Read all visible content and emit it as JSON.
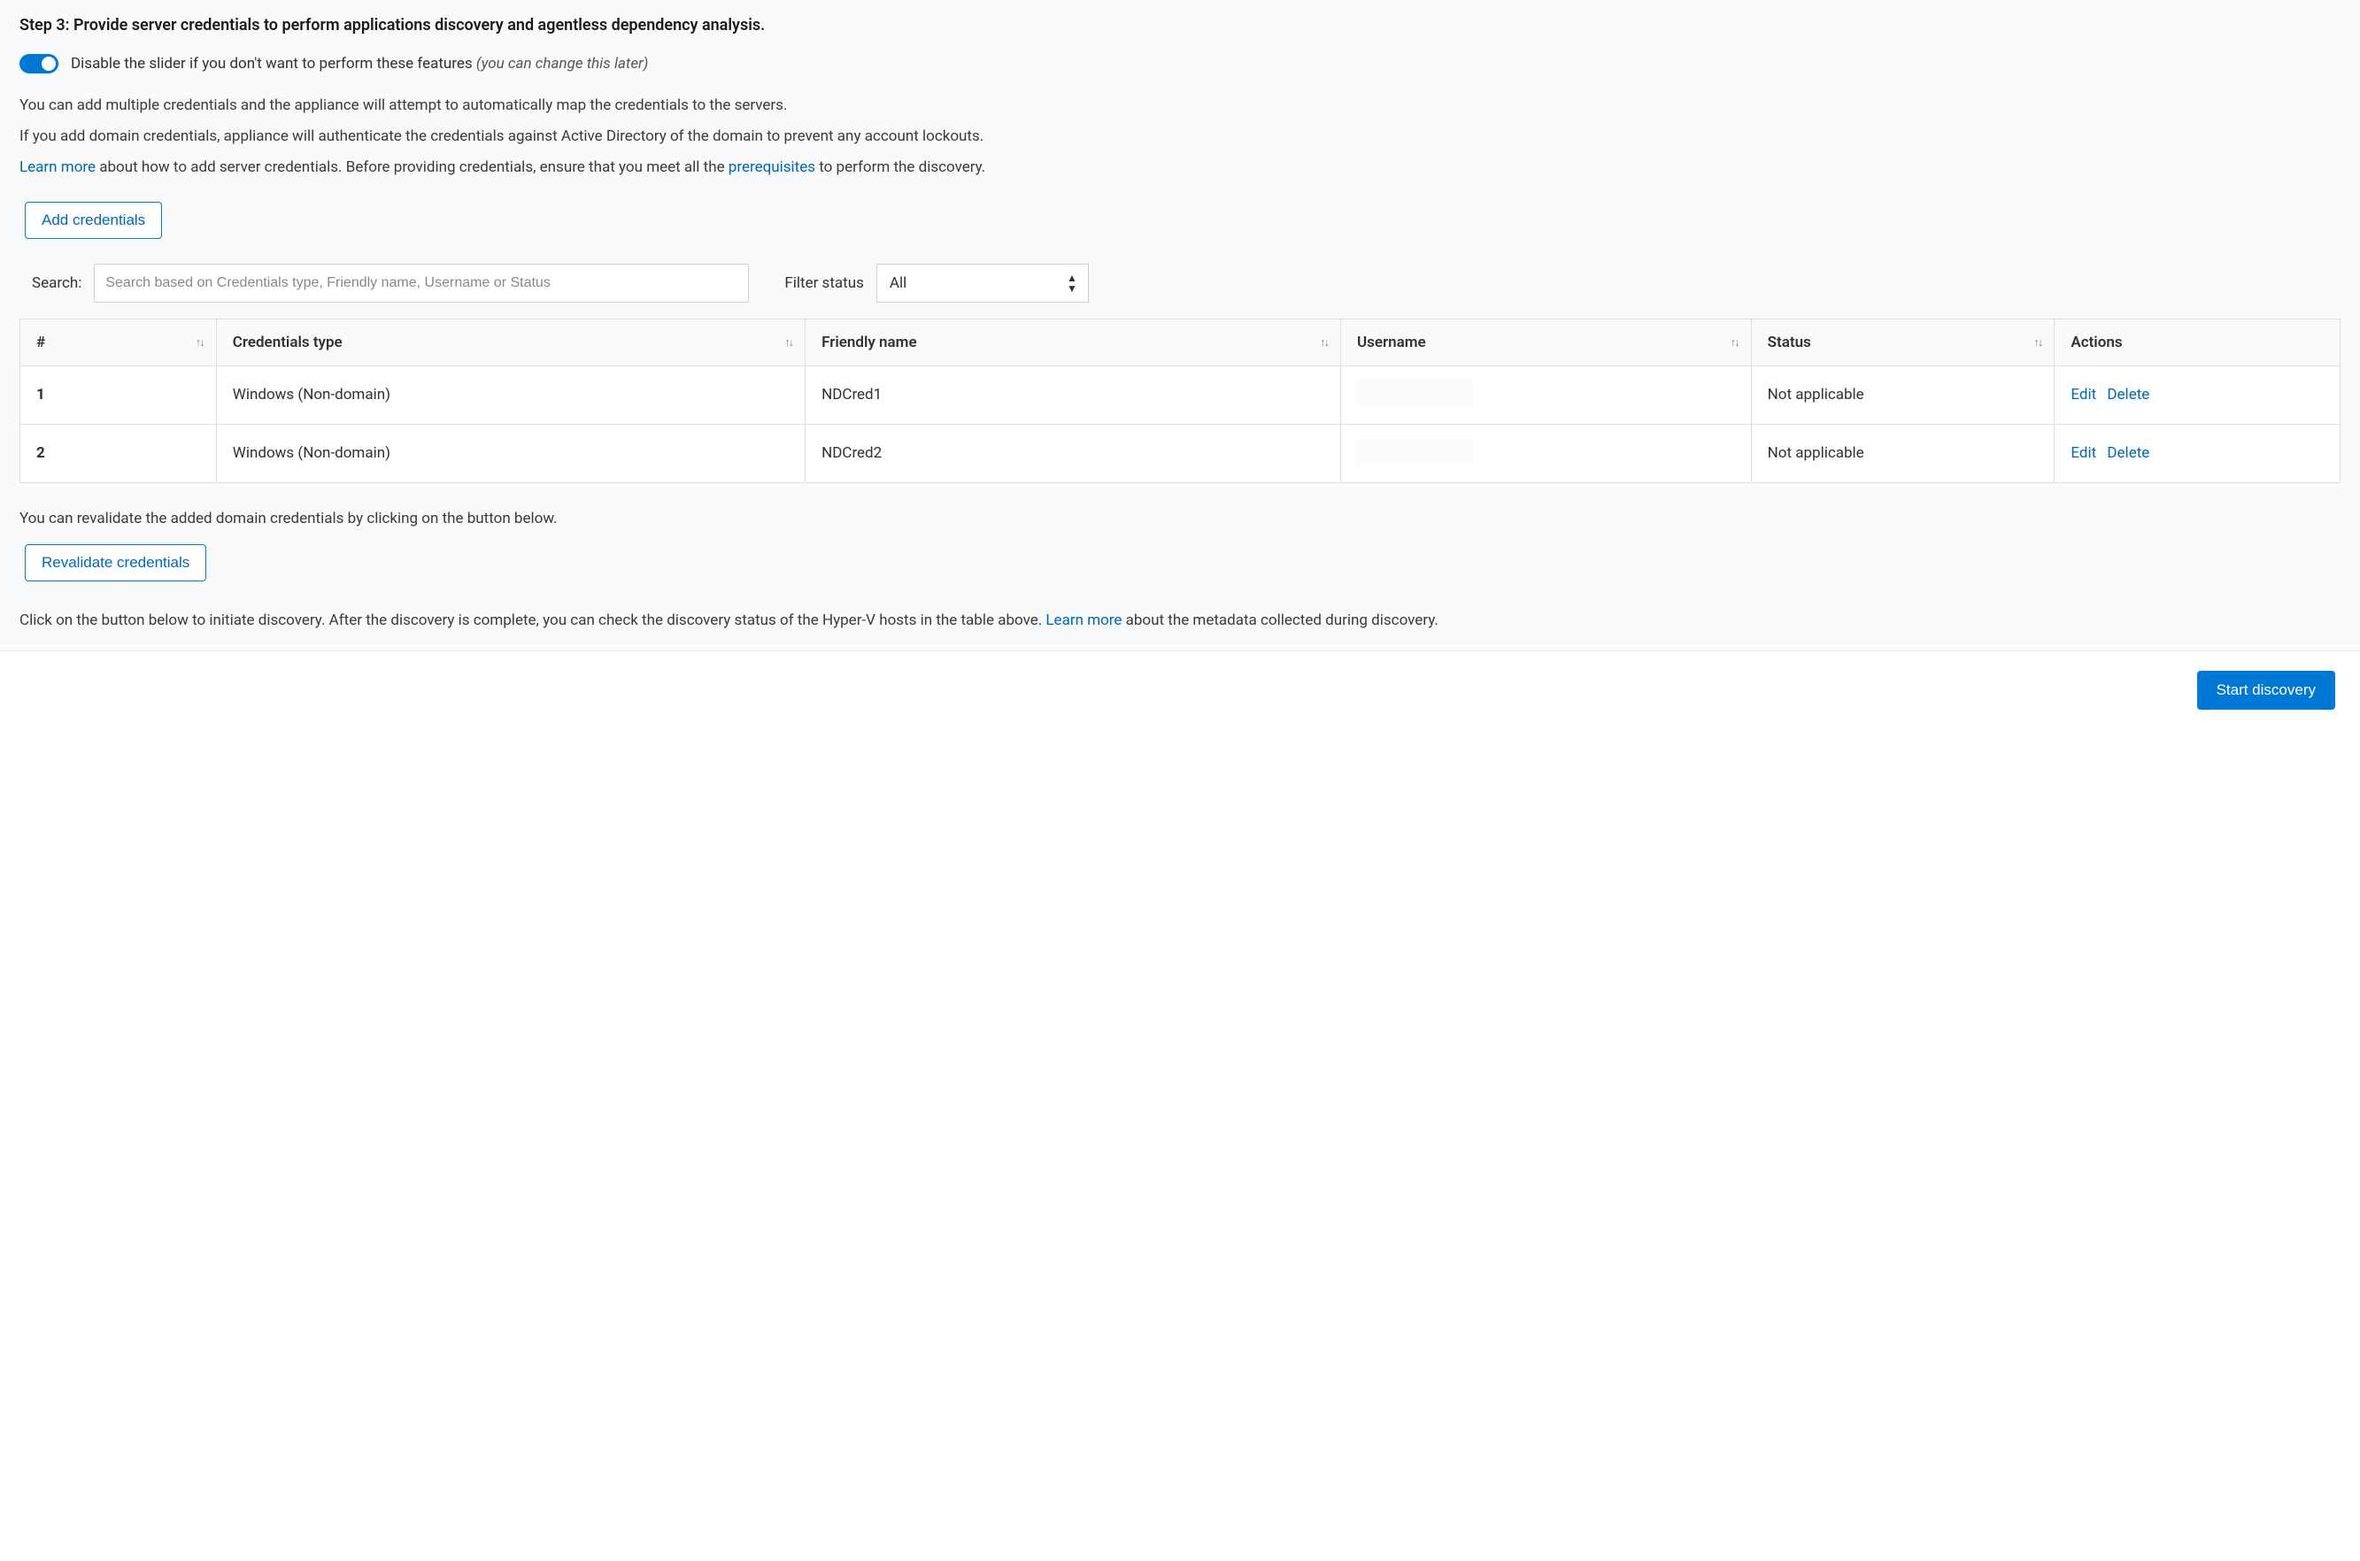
{
  "header": {
    "title": "Step 3: Provide server credentials to perform applications discovery and agentless dependency analysis."
  },
  "toggle": {
    "label_main": "Disable the slider if you don't want to perform these features ",
    "label_hint": "(you can change this later)"
  },
  "intro": {
    "line1": "You can add multiple credentials and the appliance will attempt to automatically map the credentials to the servers.",
    "line2": "If you add domain credentials, appliance will authenticate the credentials against Active Directory of the domain to prevent any account lockouts.",
    "line3_link": "Learn more",
    "line3_mid": " about how to add server credentials. Before providing credentials, ensure that you meet all the ",
    "line3_link2": "prerequisites",
    "line3_end": " to perform the discovery."
  },
  "buttons": {
    "add_credentials": "Add credentials",
    "revalidate": "Revalidate credentials",
    "start_discovery": "Start discovery"
  },
  "search": {
    "label": "Search:",
    "placeholder": "Search based on Credentials type, Friendly name, Username or Status"
  },
  "filter": {
    "label": "Filter status",
    "value": "All"
  },
  "table": {
    "headers": {
      "num": "#",
      "type": "Credentials type",
      "friendly": "Friendly name",
      "username": "Username",
      "status": "Status",
      "actions": "Actions"
    },
    "rows": [
      {
        "num": "1",
        "type": "Windows (Non-domain)",
        "friendly": "NDCred1",
        "username": "",
        "status": "Not applicable"
      },
      {
        "num": "2",
        "type": "Windows (Non-domain)",
        "friendly": "NDCred2",
        "username": "",
        "status": "Not applicable"
      }
    ],
    "action_edit": "Edit",
    "action_delete": "Delete"
  },
  "revalidate_text": "You can revalidate the added domain credentials by clicking on the button below.",
  "discovery_text": {
    "part1": "Click on the button below to initiate discovery. After the discovery is complete, you can check the discovery status of the Hyper-V hosts in the table above. ",
    "link": "Learn more",
    "part2": " about the metadata collected during discovery."
  }
}
